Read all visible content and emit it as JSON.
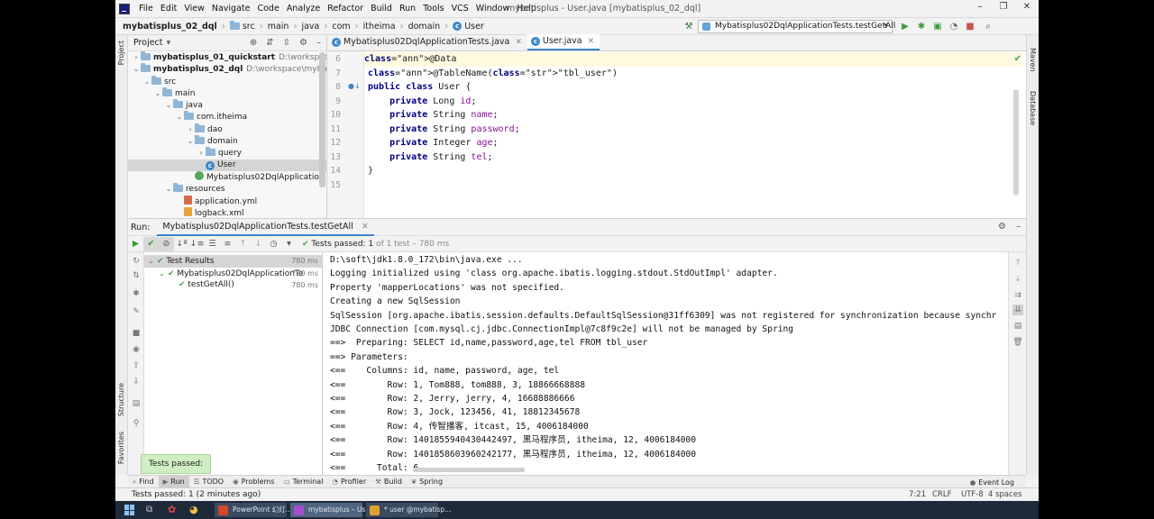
{
  "menu": {
    "items": [
      "File",
      "Edit",
      "View",
      "Navigate",
      "Code",
      "Analyze",
      "Refactor",
      "Build",
      "Run",
      "Tools",
      "VCS",
      "Window",
      "Help"
    ],
    "window_title": "mybatisplus - User.java [mybatisplus_02_dql]"
  },
  "breadcrumb": [
    "mybatisplus_02_dql",
    "src",
    "main",
    "java",
    "com",
    "itheima",
    "domain",
    "User"
  ],
  "run_config": "Mybatisplus02DqlApplicationTests.testGetAll",
  "project": {
    "title": "Project",
    "tree": [
      {
        "label": "mybatisplus_01_quickstart",
        "path": "D:\\workspace\\myb",
        "indent": 0,
        "arrow": "›",
        "icon": "folder",
        "bold": true
      },
      {
        "label": "mybatisplus_02_dql",
        "path": "D:\\workspace\\mybatisp",
        "indent": 0,
        "arrow": "⌄",
        "icon": "folder",
        "bold": true
      },
      {
        "label": "src",
        "path": "",
        "indent": 1,
        "arrow": "⌄",
        "icon": "folder"
      },
      {
        "label": "main",
        "path": "",
        "indent": 2,
        "arrow": "⌄",
        "icon": "folder"
      },
      {
        "label": "java",
        "path": "",
        "indent": 3,
        "arrow": "⌄",
        "icon": "folder"
      },
      {
        "label": "com.itheima",
        "path": "",
        "indent": 4,
        "arrow": "⌄",
        "icon": "folder"
      },
      {
        "label": "dao",
        "path": "",
        "indent": 5,
        "arrow": "›",
        "icon": "folder"
      },
      {
        "label": "domain",
        "path": "",
        "indent": 5,
        "arrow": "⌄",
        "icon": "folder"
      },
      {
        "label": "query",
        "path": "",
        "indent": 6,
        "arrow": "›",
        "icon": "folder"
      },
      {
        "label": "User",
        "path": "",
        "indent": 6,
        "arrow": "",
        "icon": "class",
        "selected": true
      },
      {
        "label": "Mybatisplus02DqlApplication",
        "path": "",
        "indent": 5,
        "arrow": "",
        "icon": "boot"
      },
      {
        "label": "resources",
        "path": "",
        "indent": 3,
        "arrow": "⌄",
        "icon": "folder"
      },
      {
        "label": "application.yml",
        "path": "",
        "indent": 4,
        "arrow": "",
        "icon": "yml"
      },
      {
        "label": "logback.xml",
        "path": "",
        "indent": 4,
        "arrow": "",
        "icon": "xml"
      }
    ]
  },
  "editor": {
    "tabs": [
      {
        "label": "Mybatisplus02DqlApplicationTests.java",
        "active": false
      },
      {
        "label": "User.java",
        "active": true
      }
    ],
    "line_numbers": [
      "6",
      "7",
      "8",
      "9",
      "10",
      "11",
      "12",
      "13",
      "14",
      "15"
    ],
    "lines": [
      "@Data",
      "@TableName(\"tbl_user\")",
      "public class User {",
      "    private Long id;",
      "    private String name;",
      "    private String password;",
      "    private Integer age;",
      "    private String tel;",
      "}",
      ""
    ]
  },
  "run": {
    "label": "Run:",
    "tab": "Mybatisplus02DqlApplicationTests.testGetAll",
    "status_prefix": "Tests passed:",
    "status_count": "1",
    "status_suffix": "of 1 test – 780 ms",
    "results": [
      {
        "label": "Test Results",
        "time": "780 ms",
        "indent": 0
      },
      {
        "label": "Mybatisplus02DqlApplicationTe",
        "time": "780 ms",
        "indent": 1
      },
      {
        "label": "testGetAll()",
        "time": "780 ms",
        "indent": 2
      }
    ],
    "console": [
      "D:\\soft\\jdk1.8.0_172\\bin\\java.exe ...",
      "Logging initialized using 'class org.apache.ibatis.logging.stdout.StdOutImpl' adapter.",
      "Property 'mapperLocations' was not specified.",
      "Creating a new SqlSession",
      "SqlSession [org.apache.ibatis.session.defaults.DefaultSqlSession@31ff6309] was not registered for synchronization because synchr",
      "JDBC Connection [com.mysql.cj.jdbc.ConnectionImpl@7c8f9c2e] will not be managed by Spring",
      "==>  Preparing: SELECT id,name,password,age,tel FROM tbl_user",
      "==> Parameters: ",
      "<==    Columns: id, name, password, age, tel",
      "<==        Row: 1, Tom888, tom888, 3, 18866668888",
      "<==        Row: 2, Jerry, jerry, 4, 16688886666",
      "<==        Row: 3, Jock, 123456, 41, 18812345678",
      "<==        Row: 4, 传智播客, itcast, 15, 4006184000",
      "<==        Row: 1401855940430442497, 黑马程序员, itheima, 12, 4006184000",
      "<==        Row: 1401858603960242177, 黑马程序员, itheima, 12, 4006184000",
      "<==      Total: 6"
    ],
    "tooltip": "Tests passed: 1"
  },
  "tool_windows": [
    {
      "label": "Find",
      "icon": "search-icon"
    },
    {
      "label": "Run",
      "icon": "play-icon",
      "active": true
    },
    {
      "label": "TODO",
      "icon": "list-icon"
    },
    {
      "label": "Problems",
      "icon": "warning-icon"
    },
    {
      "label": "Terminal",
      "icon": "terminal-icon"
    },
    {
      "label": "Profiler",
      "icon": "profiler-icon"
    },
    {
      "label": "Build",
      "icon": "hammer-icon"
    },
    {
      "label": "Spring",
      "icon": "leaf-icon"
    }
  ],
  "event_log": "Event Log",
  "side_tabs": {
    "project": "Project",
    "structure": "Structure",
    "favorites": "Favorites",
    "maven": "Maven",
    "database": "Database"
  },
  "statusbar": {
    "message": "Tests passed: 1 (2 minutes ago)",
    "position": "7:21",
    "line_sep": "CRLF",
    "encoding": "UTF-8",
    "indent": "4 spaces"
  },
  "taskbar": {
    "apps": [
      {
        "label": "PowerPoint 幻灯..."
      },
      {
        "label": "mybatisplus – Us..."
      },
      {
        "label": "* user @mybatisp..."
      }
    ]
  },
  "colors": {
    "accent": "#4083c9",
    "success": "#4aa34a",
    "keyword": "#000080",
    "string": "#067d17",
    "annotation": "#808000",
    "field": "#871094"
  }
}
